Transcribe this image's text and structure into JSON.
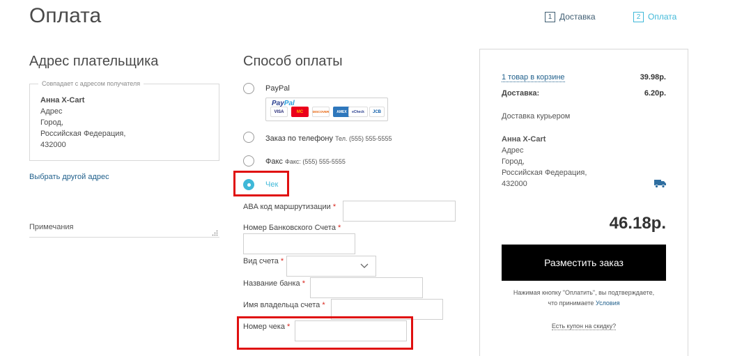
{
  "page": {
    "title": "Оплата"
  },
  "steps": [
    {
      "num": "1",
      "label": "Доставка",
      "active": false
    },
    {
      "num": "2",
      "label": "Оплата",
      "active": true
    }
  ],
  "payer": {
    "title": "Адрес плательщика",
    "legend": "Совпадает с адресом получателя",
    "name": "Анна X-Cart",
    "line1": "Адрес",
    "line2": "Город,",
    "line3": "Российская Федерация,",
    "line4": "432000",
    "change_link": "Выбрать другой адрес",
    "notes_label": "Примечания"
  },
  "payment": {
    "title": "Способ оплаты",
    "paypal": {
      "label": "PayPal",
      "logo_a": "Pay",
      "logo_b": "Pal",
      "cards": [
        "VISA",
        "MC",
        "DISCOVER",
        "AMEX",
        "eCheck",
        "JCB"
      ]
    },
    "phone": {
      "label": "Заказ по телефону",
      "extra": "Тел. (555) 555-5555"
    },
    "fax": {
      "label": "Факс",
      "extra": "Факс: (555) 555-5555"
    },
    "check": {
      "label": "Чек"
    },
    "fields": {
      "aba": "ABA код маршрутизации",
      "account": "Номер Банковского Счета",
      "type": "Вид счета",
      "bank": "Название банка",
      "holder": "Имя владельца счета",
      "check_number": "Номер чека",
      "required_mark": "*"
    }
  },
  "summary": {
    "cart_label": "1 товар в корзине",
    "cart_value": "39.98р.",
    "delivery_label": "Доставка:",
    "delivery_value": "6.20р.",
    "method": "Доставка курьером",
    "name": "Анна X-Cart",
    "line1": "Адрес",
    "line2": "Город,",
    "line3": "Российская Федерация,",
    "line4": "432000",
    "total": "46.18р.",
    "place_order": "Разместить заказ",
    "consent_1": "Нажимая кнопку \"Оплатить\", вы подтверждаете,",
    "consent_2": "что принимаете",
    "terms_link": "Условия",
    "coupon_link": "Есть купон на скидку?"
  },
  "colors": {
    "accent": "#3fb8d8",
    "link": "#1f5f8b",
    "highlight": "#e01010",
    "button": "#000000"
  }
}
